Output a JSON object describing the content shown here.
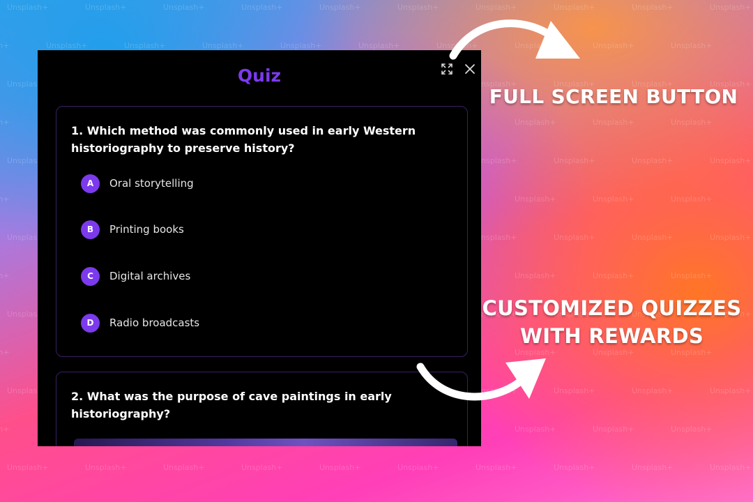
{
  "quiz": {
    "title": "Quiz",
    "questions": [
      {
        "text": "1. Which method was commonly used in early Western historiography to preserve history?",
        "options": [
          {
            "letter": "A",
            "text": "Oral storytelling"
          },
          {
            "letter": "B",
            "text": "Printing books"
          },
          {
            "letter": "C",
            "text": "Digital archives"
          },
          {
            "letter": "D",
            "text": "Radio broadcasts"
          }
        ]
      },
      {
        "text": "2. What was the purpose of cave paintings in early historiography?"
      }
    ]
  },
  "annotations": {
    "fullscreen_label": "FULL SCREEN BUTTON",
    "quiz_label_line1": "CUSTOMIZED QUIZZES",
    "quiz_label_line2": "WITH REWARDS"
  },
  "icons": {
    "fullscreen": "fullscreen-icon",
    "close": "close-icon",
    "arrow": "curved-arrow-icon"
  },
  "watermark_text": "Unsplash+",
  "colors": {
    "accent": "#7c3aed",
    "window_bg": "#000000",
    "card_border": "#3b1f66"
  }
}
